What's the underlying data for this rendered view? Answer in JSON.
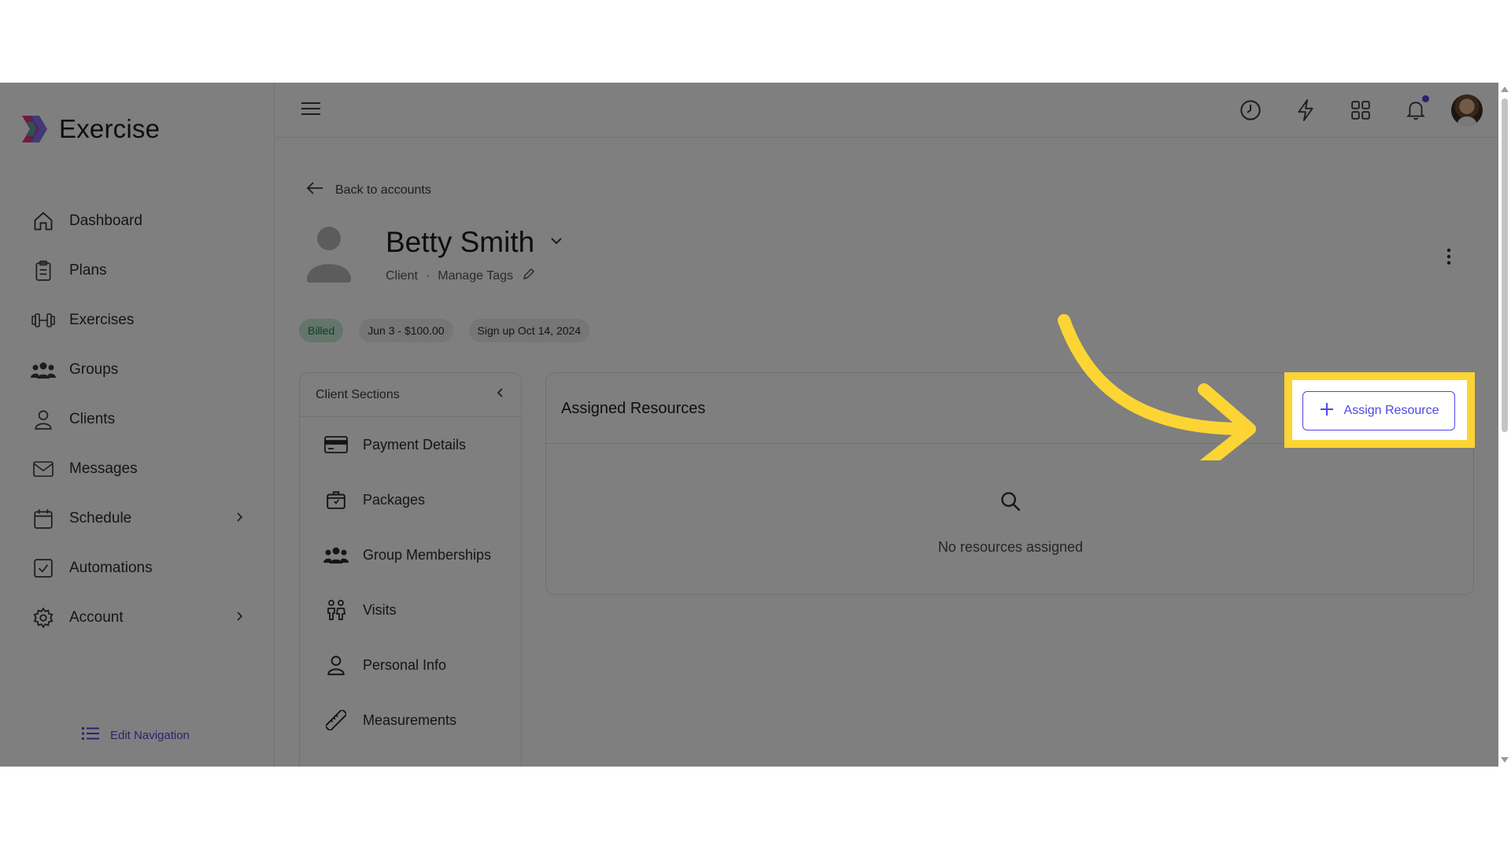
{
  "app": {
    "name": "Exercise",
    "accent_color": "#4f46e5",
    "highlight_color": "#fcd535"
  },
  "sidebar": {
    "items": [
      {
        "label": "Dashboard",
        "icon": "home-icon"
      },
      {
        "label": "Plans",
        "icon": "clipboard-icon"
      },
      {
        "label": "Exercises",
        "icon": "dumbbell-icon"
      },
      {
        "label": "Groups",
        "icon": "users-icon"
      },
      {
        "label": "Clients",
        "icon": "user-icon"
      },
      {
        "label": "Messages",
        "icon": "mail-icon"
      },
      {
        "label": "Schedule",
        "icon": "calendar-icon",
        "has_submenu": true
      },
      {
        "label": "Automations",
        "icon": "checkbox-icon"
      },
      {
        "label": "Account",
        "icon": "gear-icon",
        "has_submenu": true
      }
    ],
    "edit_navigation_label": "Edit Navigation"
  },
  "topbar": {
    "icons": [
      "menu-icon",
      "clock-icon",
      "lightning-icon",
      "grid-icon",
      "bell-icon",
      "avatar"
    ]
  },
  "client": {
    "back_label": "Back to accounts",
    "name": "Betty Smith",
    "role": "Client",
    "separator": "·",
    "manage_tags_label": "Manage Tags",
    "chips": [
      {
        "label": "Billed",
        "variant": "success"
      },
      {
        "label": "Jun 3 - $100.00",
        "variant": "neutral"
      },
      {
        "label": "Sign up Oct 14, 2024",
        "variant": "neutral"
      }
    ]
  },
  "client_sections": {
    "title": "Client Sections",
    "items": [
      {
        "label": "Payment Details",
        "icon": "credit-card-icon"
      },
      {
        "label": "Packages",
        "icon": "package-icon"
      },
      {
        "label": "Group Memberships",
        "icon": "users-icon"
      },
      {
        "label": "Visits",
        "icon": "visits-icon"
      },
      {
        "label": "Personal Info",
        "icon": "user-icon"
      },
      {
        "label": "Measurements",
        "icon": "ruler-icon"
      }
    ]
  },
  "resources": {
    "title": "Assigned Resources",
    "assign_button_label": "Assign Resource",
    "empty_state": "No resources assigned"
  }
}
